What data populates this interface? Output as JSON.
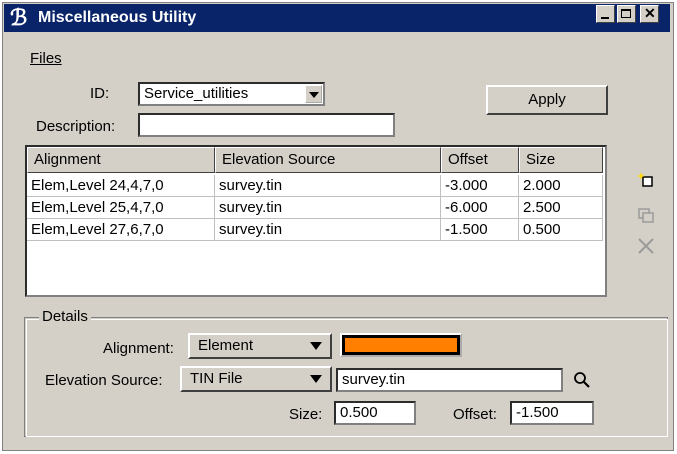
{
  "window": {
    "title": "Miscellaneous Utility"
  },
  "menu": {
    "files": "Files"
  },
  "form": {
    "id_label": "ID:",
    "id_value": "Service_utilities",
    "description_label": "Description:",
    "description_value": "",
    "apply_label": "Apply"
  },
  "table": {
    "headers": [
      "Alignment",
      "Elevation Source",
      "Offset",
      "Size"
    ],
    "rows": [
      [
        "Elem,Level 24,4,7,0",
        "survey.tin",
        "-3.000",
        "2.000"
      ],
      [
        "Elem,Level 25,4,7,0",
        "survey.tin",
        "-6.000",
        "2.500"
      ],
      [
        "Elem,Level 27,6,7,0",
        "survey.tin",
        "-1.500",
        "0.500"
      ]
    ]
  },
  "details": {
    "legend": "Details",
    "alignment_label": "Alignment:",
    "alignment_value": "Element",
    "alignment_color": "#ff8000",
    "elevation_label": "Elevation Source:",
    "elevation_value": "TIN File",
    "elevation_file": "survey.tin",
    "size_label": "Size:",
    "size_value": "0.500",
    "offset_label": "Offset:",
    "offset_value": "-1.500"
  },
  "icons": [
    "add-row-icon",
    "copy-row-icon",
    "delete-row-icon",
    "browse-icon"
  ]
}
